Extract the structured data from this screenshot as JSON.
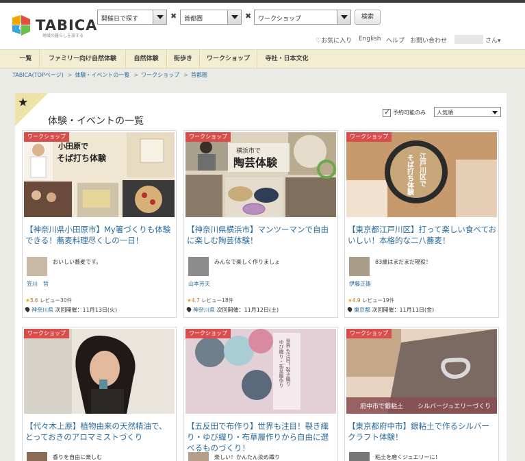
{
  "header": {
    "logo_text": "TABICA",
    "logo_tag": "地域の暮らしを旅する",
    "search": {
      "date_select": "開催日で探す",
      "area_select": "首都圏",
      "category_select": "ワークショップ",
      "times_symbol": "✖",
      "button_label": "検索"
    },
    "util": {
      "favorites": "♡お気に入り",
      "english": "English",
      "help": "ヘルプ",
      "contact": "お問い合わせ",
      "user_suffix": "さん▾"
    }
  },
  "nav": [
    "一覧",
    "ファミリー向け自然体験",
    "自然体験",
    "街歩き",
    "ワークショップ",
    "寺社・日本文化"
  ],
  "breadcrumb": [
    "TABICA(TOPページ)",
    "体験・イベントの一覧",
    "ワークショップ",
    "首都圏"
  ],
  "breadcrumb_sep": ">",
  "page": {
    "title": "体験・イベントの一覧",
    "filter_label": "予約可能のみ",
    "sort_value": "人気順"
  },
  "cards": [
    {
      "badge": "ワークショップ",
      "title": "【神奈川県小田原市】My箸づくりも体験できる！蕎麦料理尽くしの一日！",
      "img_text": [
        "小田原で",
        "そば打ち体験"
      ],
      "host_msg": "おいしい蕎麦です。",
      "host_name": "笠川　哲",
      "rating": "3.6",
      "reviews": "レビュー30件",
      "pref": "神奈川県",
      "next_date": "次回開催：11月13日(火)"
    },
    {
      "badge": "ワークショップ",
      "title": "【神奈川県横浜市】マンツーマンで自由に楽しむ陶芸体験！",
      "img_text": [
        "横浜市で",
        "陶芸体験"
      ],
      "host_msg": "みんなで楽しく作りましょ",
      "host_name": "山本芳夫",
      "rating": "4.7",
      "reviews": "レビュー18件",
      "pref": "神奈川県",
      "next_date": "次回開催：11月12日(土)"
    },
    {
      "badge": "ワークショップ",
      "title": "【東京都江戸川区】打って楽しい食べておいしい！本格的な二八蕎麦！",
      "img_text": [
        "江戸川区で",
        "そば打ち体験"
      ],
      "host_msg": "83歳はまだまだ現役！",
      "host_name": "伊藤正雄",
      "rating": "4.9",
      "reviews": "レビュー19件",
      "pref": "東京都",
      "next_date": "次回開催：11月11日(金)"
    },
    {
      "badge": "ワークショップ",
      "title": "【代々木上原】植物由来の天然精油で、とっておきのアロマミストづくり",
      "img_text": [],
      "host_msg": "香りを自由に楽しむ",
      "host_name": "",
      "rating": "",
      "reviews": "",
      "pref": "",
      "next_date": ""
    },
    {
      "badge": "ワークショップ",
      "title": "【五反田で布作り】世界も注目！裂き織り・ゆび織り・布草履作りから自由に選べるものづくり！",
      "img_text": [
        "世界も注目！裂き織り",
        "ゆび織り・布草履作り"
      ],
      "host_msg": "楽しい！かんたん染め織り",
      "host_name": "",
      "rating": "",
      "reviews": "",
      "pref": "",
      "next_date": ""
    },
    {
      "badge": "ワークショップ",
      "title": "【東京都府中市】銀粘土で作るシルバークラフト体験！",
      "img_text": [
        "府中市で銀粘土",
        "シルバージュエリーづくり"
      ],
      "host_msg": "粘土を磨くジュエリーに！",
      "host_name": "",
      "rating": "",
      "reviews": "",
      "pref": "",
      "next_date": ""
    }
  ],
  "colors": {
    "accent_link": "#2a6a9a",
    "badge_red": "#d94d4d",
    "nav_bg": "#f3edd2",
    "star": "#e8a318"
  }
}
